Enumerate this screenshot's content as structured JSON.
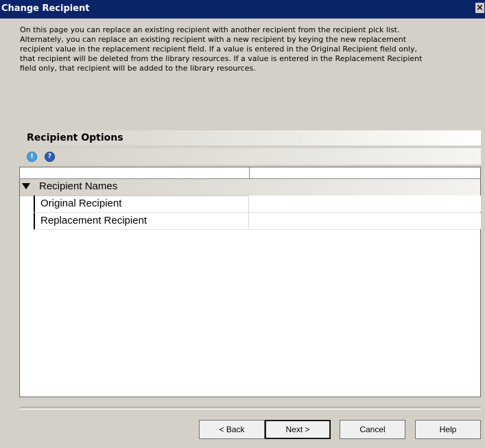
{
  "window": {
    "title": "Change Recipient",
    "close_glyph": "×"
  },
  "description": "On this page you can replace an existing recipient with another recipient from the recipient pick list.\nAlternately, you can replace an existing recipient with a new recipient by keying the new replacement\nrecipient value in the replacement recipient field.  If a value is entered in the Original Recipient field only,\nthat recipient will be deleted from the library resources.  If a value is entered in the Replacement Recipient\nfield only, that recipient will be added to the library resources.",
  "section": {
    "title": "Recipient Options",
    "icons": [
      {
        "name": "info-icon",
        "glyph": "i"
      },
      {
        "name": "help-icon",
        "glyph": "?"
      }
    ]
  },
  "grid": {
    "group_label": "Recipient Names",
    "rows": [
      {
        "name": "Original Recipient",
        "value": ""
      },
      {
        "name": "Replacement Recipient",
        "value": ""
      }
    ]
  },
  "buttons": {
    "back": "< Back",
    "next": "Next >",
    "cancel": "Cancel",
    "help": "Help"
  }
}
